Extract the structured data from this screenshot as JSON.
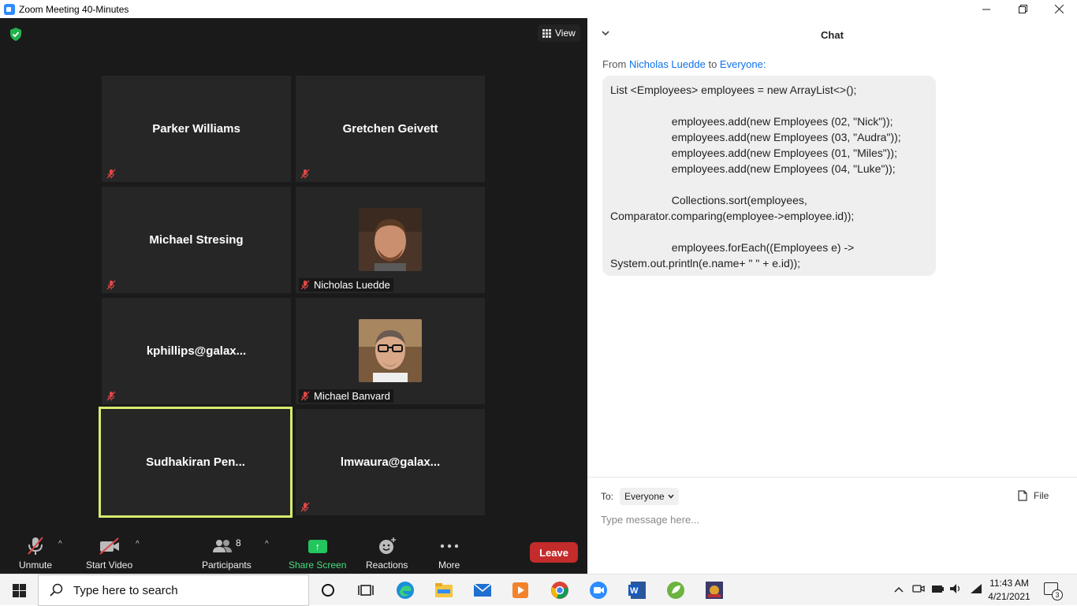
{
  "window": {
    "title": "Zoom Meeting 40-Minutes",
    "controls": [
      "minimize",
      "restore",
      "close"
    ]
  },
  "meeting": {
    "view_label": "View",
    "tiles": [
      {
        "name": "Parker Williams",
        "muted": true,
        "has_video": false
      },
      {
        "name": "Gretchen Geivett",
        "muted": true,
        "has_video": false
      },
      {
        "name": "Michael Stresing",
        "muted": true,
        "has_video": false
      },
      {
        "name": "Nicholas Luedde",
        "muted": true,
        "has_video": true
      },
      {
        "name": "kphillips@galax...",
        "muted": true,
        "has_video": false
      },
      {
        "name": "Michael Banvard",
        "muted": true,
        "has_video": true
      },
      {
        "name": "Sudhakiran  Pen...",
        "muted": false,
        "has_video": false,
        "active_speaker": true
      },
      {
        "name": "lmwaura@galax...",
        "muted": true,
        "has_video": false
      }
    ]
  },
  "toolbar": {
    "unmute_label": "Unmute",
    "start_video_label": "Start Video",
    "participants_label": "Participants",
    "participants_count": "8",
    "share_label": "Share Screen",
    "reactions_label": "Reactions",
    "more_label": "More",
    "leave_label": "Leave",
    "share_color": "#22c55e",
    "leave_color": "#c42b2b"
  },
  "chat": {
    "title": "Chat",
    "from_prefix": "From",
    "sender": "Nicholas Luedde",
    "to_word": "to",
    "recipient": "Everyone:",
    "message": "List <Employees> employees = new ArrayList<>();\n\n                    employees.add(new Employees (02, \"Nick\"));\n                    employees.add(new Employees (03, \"Audra\"));\n                    employees.add(new Employees (01, \"Miles\"));\n                    employees.add(new Employees (04, \"Luke\"));\n\n                    Collections.sort(employees,\nComparator.comparing(employee->employee.id));\n\n                    employees.forEach((Employees e) ->\nSystem.out.println(e.name+ \" \" + e.id));",
    "to_label": "To:",
    "to_value": "Everyone",
    "file_label": "File",
    "input_placeholder": "Type message here..."
  },
  "taskbar": {
    "search_placeholder": "Type here to search",
    "time": "11:43 AM",
    "date": "4/21/2021",
    "notification_count": "3",
    "pinned_icons": [
      "task-view-icon",
      "timeline-icon",
      "edge-icon",
      "file-explorer-icon",
      "mail-icon",
      "media-icon",
      "chrome-icon",
      "zoom-icon",
      "word-icon",
      "spring-icon",
      "game-icon"
    ]
  }
}
